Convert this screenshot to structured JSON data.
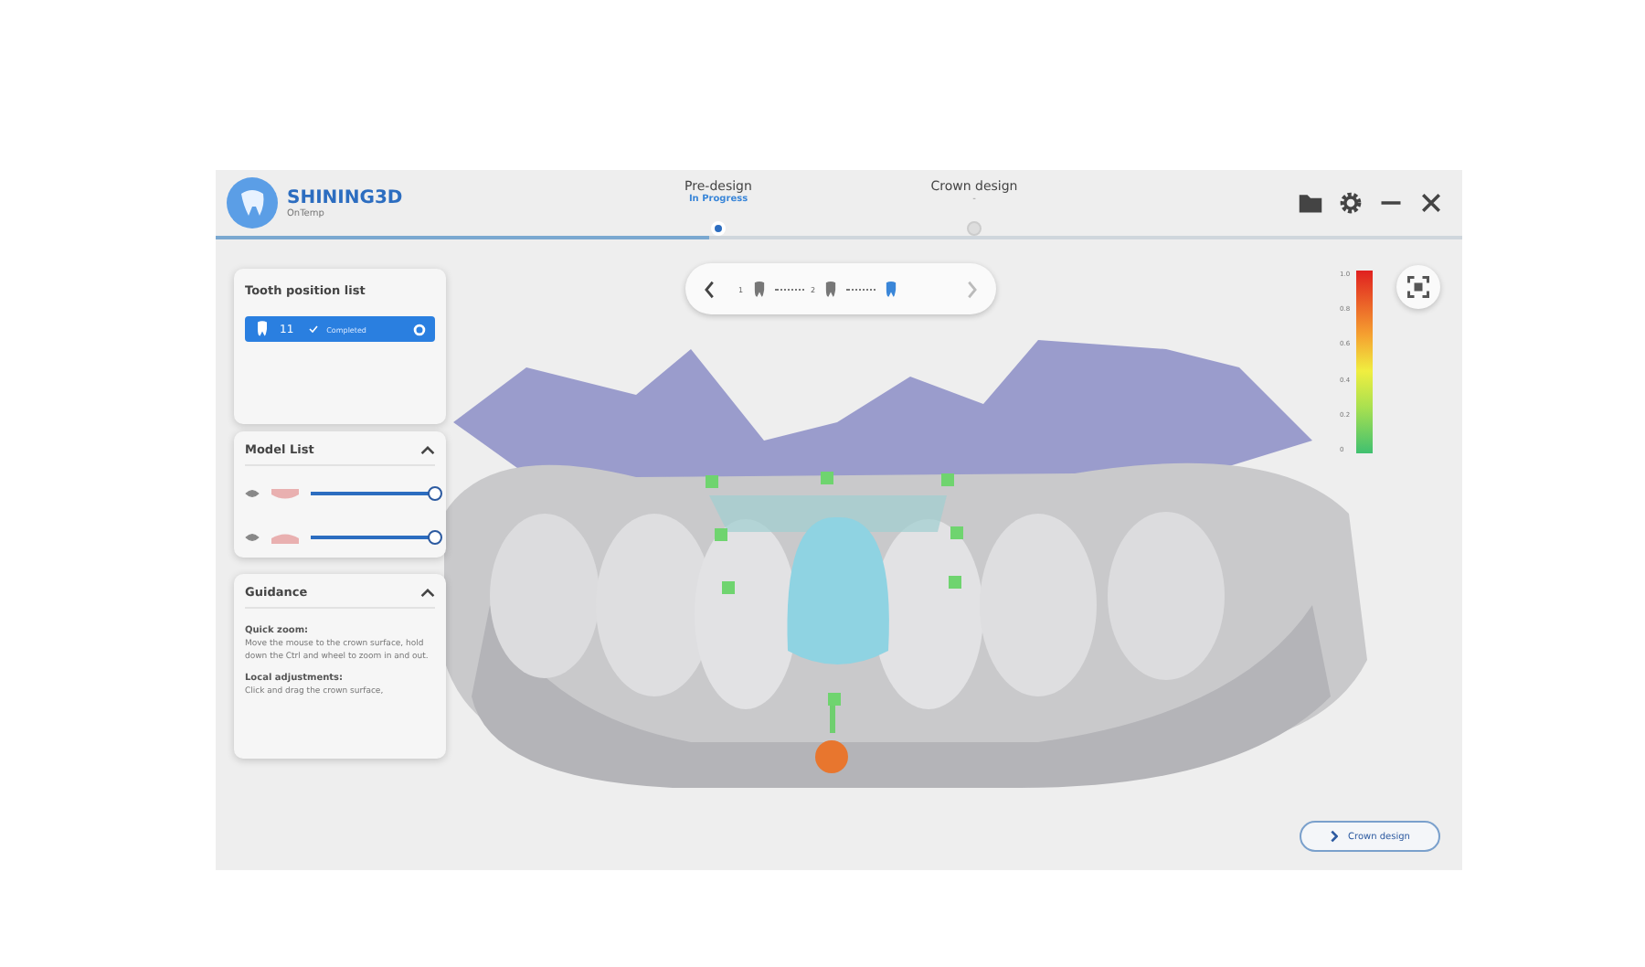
{
  "app": {
    "name": "SHINING3D",
    "subtitle": "OnTemp"
  },
  "steps": [
    {
      "title": "Pre-design",
      "status": "In Progress",
      "selected": true
    },
    {
      "title": "Crown design",
      "status": "-",
      "selected": false
    }
  ],
  "toolbar": {
    "tools": [
      {
        "number": "1",
        "selected": false
      },
      {
        "number": "2",
        "selected": false
      },
      {
        "selected": true
      }
    ]
  },
  "tooth_panel": {
    "title": "Tooth position list",
    "items": [
      {
        "tooth": "11",
        "status": "Completed",
        "selected": true
      }
    ]
  },
  "model_panel": {
    "title": "Model List",
    "expanded": true,
    "models": [
      {
        "kind": "upper",
        "visible": true,
        "level": 1
      },
      {
        "kind": "lower",
        "visible": true,
        "level": 1
      }
    ]
  },
  "guidance": {
    "title": "Guidance",
    "expanded": true,
    "sections": [
      {
        "heading": "Quick zoom:",
        "text": "Move the mouse to the crown surface, hold down the Ctrl and wheel to zoom in and out."
      },
      {
        "heading": "Local adjustments:",
        "text": "Click and drag the crown surface,"
      }
    ]
  },
  "scale": {
    "ticks": [
      "1.0",
      "0.8",
      "0.6",
      "0.4",
      "0.2",
      "0"
    ]
  },
  "next_button": "Crown design"
}
